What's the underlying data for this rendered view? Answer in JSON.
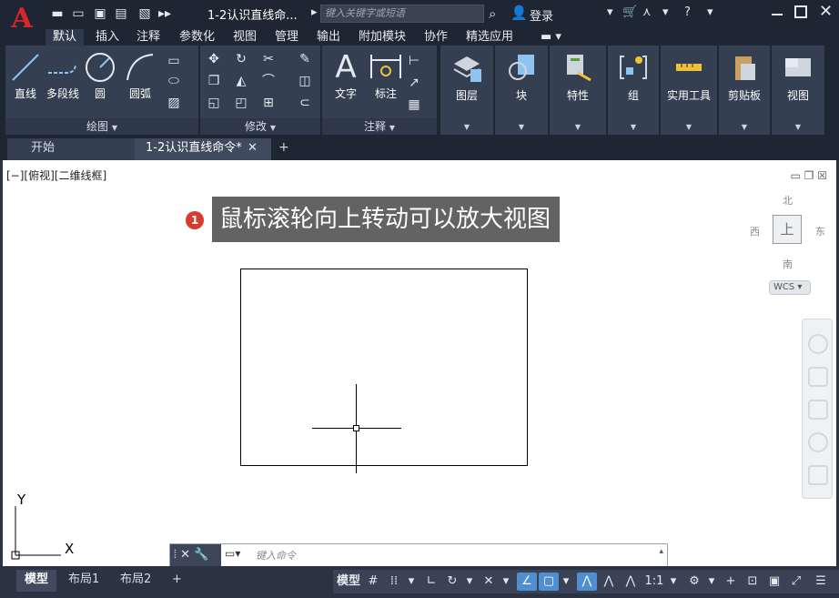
{
  "app": {
    "logo": "A",
    "title": "1-2认识直线命...",
    "search_placeholder": "键入关键字或短语",
    "login": "登录"
  },
  "ribbon_tabs": [
    "默认",
    "插入",
    "注释",
    "参数化",
    "视图",
    "管理",
    "输出",
    "附加模块",
    "协作",
    "精选应用"
  ],
  "active_ribbon_tab": "默认",
  "panels": {
    "draw": {
      "title": "绘图",
      "tools": [
        "直线",
        "多段线",
        "圆",
        "圆弧"
      ]
    },
    "modify": {
      "title": "修改"
    },
    "annotation": {
      "title": "注释",
      "tools": [
        "文字",
        "标注"
      ]
    },
    "layers": {
      "label": "图层"
    },
    "block": {
      "label": "块"
    },
    "properties": {
      "label": "特性"
    },
    "groups": {
      "label": "组"
    },
    "utilities": {
      "label": "实用工具"
    },
    "clipboard": {
      "label": "剪贴板"
    },
    "view": {
      "label": "视图"
    }
  },
  "file_tabs": {
    "start": "开始",
    "current": "1-2认识直线命令*"
  },
  "viewport": {
    "label": "[−][俯视][二维线框]",
    "callout_number": "1",
    "callout_text": "鼠标滚轮向上转动可以放大视图",
    "compass": {
      "north": "北",
      "south": "南",
      "east": "东",
      "west": "西",
      "top": "上"
    },
    "wcs": "WCS",
    "ucs_x": "X",
    "ucs_y": "Y"
  },
  "command_line": {
    "placeholder": "键入命令"
  },
  "layout_tabs": [
    "模型",
    "布局1",
    "布局2"
  ],
  "active_layout_tab": "模型",
  "status": {
    "model": "模型",
    "scale": "1:1"
  },
  "colors": {
    "accent": "#4f8fd0",
    "logo": "#d8262c",
    "callout_bg": "#636363",
    "badge": "#d63b2f"
  }
}
